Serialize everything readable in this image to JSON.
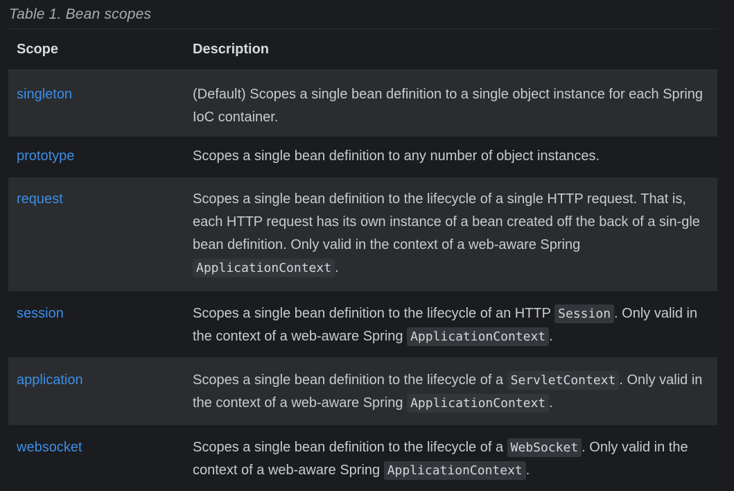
{
  "caption": "Table 1. Bean scopes",
  "header": {
    "scope": "Scope",
    "description": "Description"
  },
  "rows": [
    {
      "scope": "singleton",
      "parts": [
        "(Default) Scopes a single bean definition to a single object instance for each Spring IoC container."
      ]
    },
    {
      "scope": "prototype",
      "parts": [
        "Scopes a single bean definition to any number of object instances."
      ]
    },
    {
      "scope": "request",
      "parts": [
        "Scopes a single bean definition to the lifecycle of a single HTTP request. That is, each HTTP request has its own instance of a bean created off the back of a sin-gle bean definition. Only valid in the context of a web-aware Spring ",
        "ApplicationContext",
        "."
      ]
    },
    {
      "scope": "session",
      "parts": [
        "Scopes a single bean definition to the lifecycle of an HTTP ",
        "Session",
        ". Only valid in the context of a web-aware Spring ",
        "ApplicationContext",
        "."
      ]
    },
    {
      "scope": "application",
      "parts": [
        "Scopes a single bean definition to the lifecycle of a ",
        "ServletContext",
        ". Only valid in the context of a web-aware Spring ",
        "ApplicationContext",
        "."
      ]
    },
    {
      "scope": "websocket",
      "parts": [
        "Scopes a single bean definition to the lifecycle of a ",
        "WebSocket",
        ". Only valid in the context of a web-aware Spring ",
        "ApplicationContext",
        "."
      ]
    }
  ]
}
